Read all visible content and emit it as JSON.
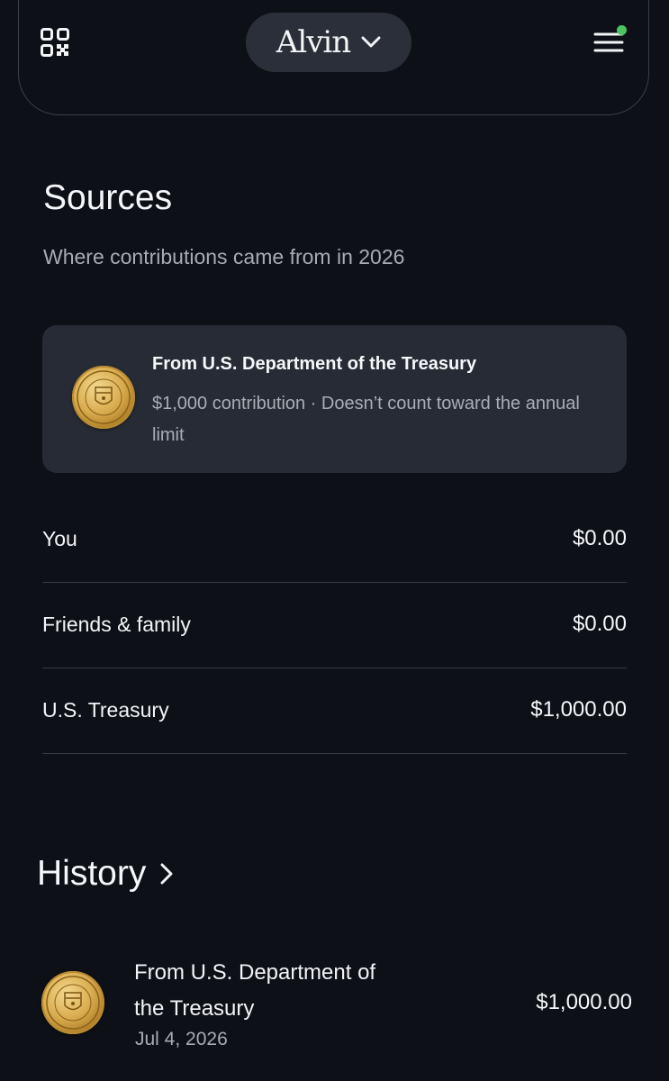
{
  "header": {
    "account_name": "Alvin",
    "qr_icon": "qr-code-icon",
    "chevron_icon": "chevron-down-icon",
    "menu_icon": "hamburger-menu-icon",
    "notification_dot_color": "#4cc463"
  },
  "sources": {
    "title": "Sources",
    "subtitle": "Where contributions came from in 2026",
    "card": {
      "icon": "treasury-seal-icon",
      "title": "From U.S. Department of the Treasury",
      "description": "$1,000 contribution · Doesn’t count toward the annual limit"
    },
    "rows": [
      {
        "label": "You",
        "value": "$0.00"
      },
      {
        "label": "Friends & family",
        "value": "$0.00"
      },
      {
        "label": "U.S. Treasury",
        "value": "$1,000.00"
      }
    ]
  },
  "history": {
    "title": "History",
    "chevron_icon": "chevron-right-icon",
    "items": [
      {
        "icon": "treasury-seal-icon",
        "name": "From U.S. Department of the Treasury",
        "date": "Jul 4, 2026",
        "amount": "$1,000.00"
      }
    ]
  },
  "colors": {
    "background": "#0d1016",
    "card": "#262b35",
    "pill": "#2a2f3a",
    "muted_text": "#a7abb4",
    "divider": "#363b46"
  }
}
